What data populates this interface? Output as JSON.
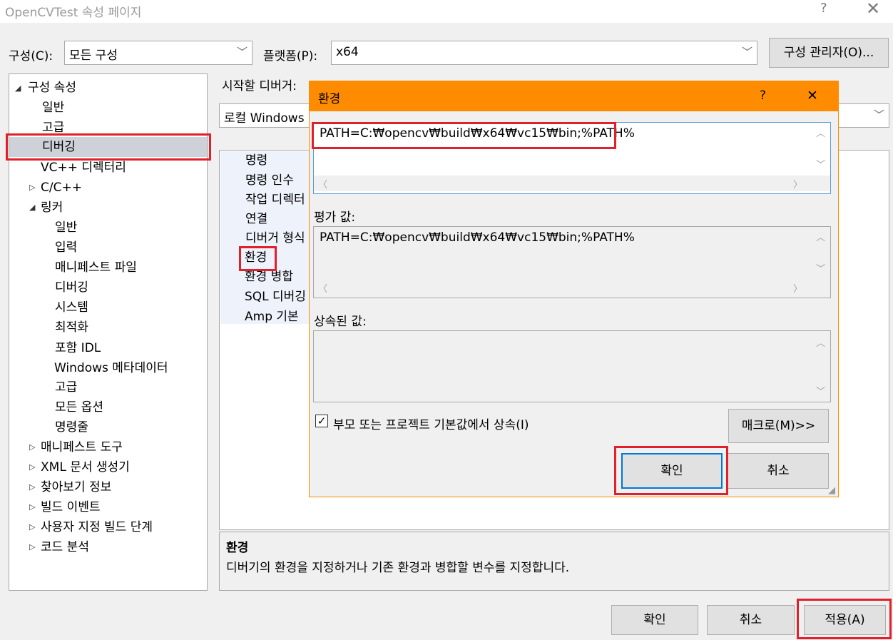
{
  "window": {
    "title": "OpenCVTest 속성 페이지",
    "help_icon": "?",
    "close_icon": "✕"
  },
  "toolbar": {
    "config_label": "구성(C):",
    "config_value": "모든 구성",
    "platform_label": "플랫폼(P):",
    "platform_value": "x64",
    "config_manager_button": "구성 관리자(O)..."
  },
  "tree": {
    "root": "구성 속성",
    "items": [
      "일반",
      "고급",
      "디버깅",
      "VC++ 디렉터리",
      "C/C++",
      "링커",
      "일반",
      "입력",
      "매니페스트 파일",
      "디버깅",
      "시스템",
      "최적화",
      "포함 IDL",
      "Windows 메타데이터",
      "고급",
      "모든 옵션",
      "명령줄",
      "매니페스트 도구",
      "XML 문서 생성기",
      "찾아보기 정보",
      "빌드 이벤트",
      "사용자 지정 빌드 단계",
      "코드 분석"
    ],
    "selected": "디버깅"
  },
  "debugger": {
    "label": "시작할 디버거:",
    "value": "로컬 Windows"
  },
  "properties": [
    "명령",
    "명령 인수",
    "작업 디렉터",
    "연결",
    "디버거 형식",
    "환경",
    "환경 병합",
    "SQL 디버깅",
    "Amp 기본 "
  ],
  "description": {
    "title": "환경",
    "text": "디버기의 환경을 지정하거나 기존 환경과 병합할 변수를 지정합니다."
  },
  "dialog": {
    "title": "환경",
    "help": "?",
    "close": "✕",
    "env_value": "PATH=C:₩opencv₩build₩x64₩vc15₩bin;%PATH%",
    "evaluated_label": "평가 값:",
    "evaluated_value": "PATH=C:₩opencv₩build₩x64₩vc15₩bin;%PATH%",
    "inherited_label": "상속된 값:",
    "inherit_checkbox": "부모 또는 프로젝트 기본값에서 상속(I)",
    "inherit_checked": true,
    "macro_button": "매크로(M)>>",
    "ok_button": "확인",
    "cancel_button": "취소"
  },
  "footer": {
    "ok": "확인",
    "cancel": "취소",
    "apply": "적용(A)"
  },
  "colors": {
    "dialog_accent": "#ff8c00",
    "highlight_box": "#e0202a",
    "selected_bg": "#cfd1d8"
  }
}
